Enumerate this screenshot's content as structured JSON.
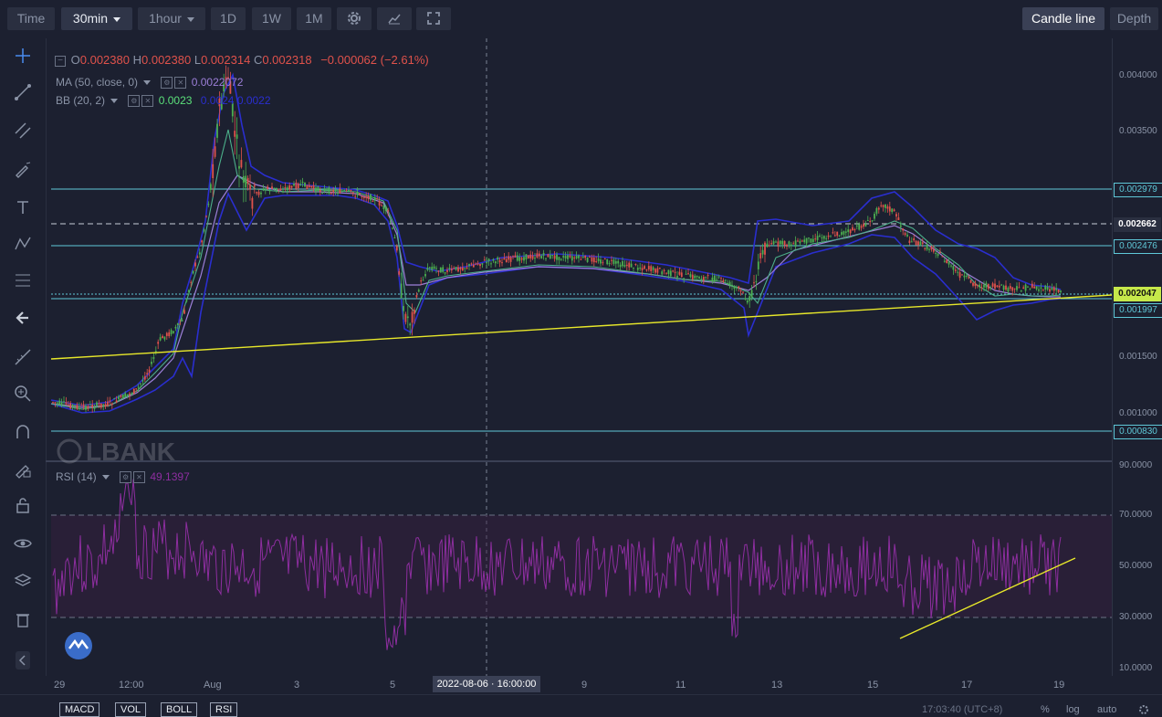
{
  "toolbar": {
    "time": "Time",
    "interval": "30min",
    "interval2": "1hour",
    "d1": "1D",
    "w1": "1W",
    "m1": "1M",
    "candle_line": "Candle line",
    "depth": "Depth"
  },
  "ohlc": {
    "o_label": "O",
    "o": "0.002380",
    "h_label": "H",
    "h": "0.002380",
    "l_label": "L",
    "l": "0.002314",
    "c_label": "C",
    "c": "0.002318",
    "change": "−0.000062 (−2.61%)"
  },
  "ma": {
    "label": "MA (50, close, 0)",
    "value": "0.0022072"
  },
  "bb": {
    "label": "BB (20, 2)",
    "value1": "0.0023",
    "value2": "0.0024",
    "value3": "0.0022"
  },
  "rsi": {
    "label": "RSI (14)",
    "value": "49.1397"
  },
  "watermark": "LBANK",
  "price_axis": [
    "0.004000",
    "0.003500",
    "0.001500",
    "0.001000"
  ],
  "price_levels": [
    {
      "value": "0.002979",
      "style": "solid"
    },
    {
      "value": "0.002662",
      "style": "dashed"
    },
    {
      "value": "0.002476",
      "style": "solid"
    },
    {
      "value": "0.002047",
      "style": "current"
    },
    {
      "value": "0.001997",
      "style": "solid"
    },
    {
      "value": "0.000830",
      "style": "solid"
    }
  ],
  "rsi_axis": [
    "90.0000",
    "70.0000",
    "50.0000",
    "30.0000",
    "10.0000"
  ],
  "time_axis": [
    "29",
    "12:00",
    "Aug",
    "3",
    "5",
    "9",
    "11",
    "13",
    "15",
    "17",
    "19"
  ],
  "crosshair_time": "2022-08-06 · 16:00:00",
  "bottom_tabs": [
    "MACD",
    "VOL",
    "BOLL",
    "RSI"
  ],
  "status": {
    "clock": "17:03:40 (UTC+8)",
    "percent": "%",
    "log": "log",
    "auto": "auto"
  },
  "colors": {
    "background": "#1c2030",
    "up": "#4caf50",
    "down": "#e0524b",
    "bb_band": "#2a2ecf",
    "ma": "#9c7fd8",
    "trendline": "#e8e82a",
    "hline": "#5fc8d8",
    "rsi": "#8e2ea0"
  }
}
